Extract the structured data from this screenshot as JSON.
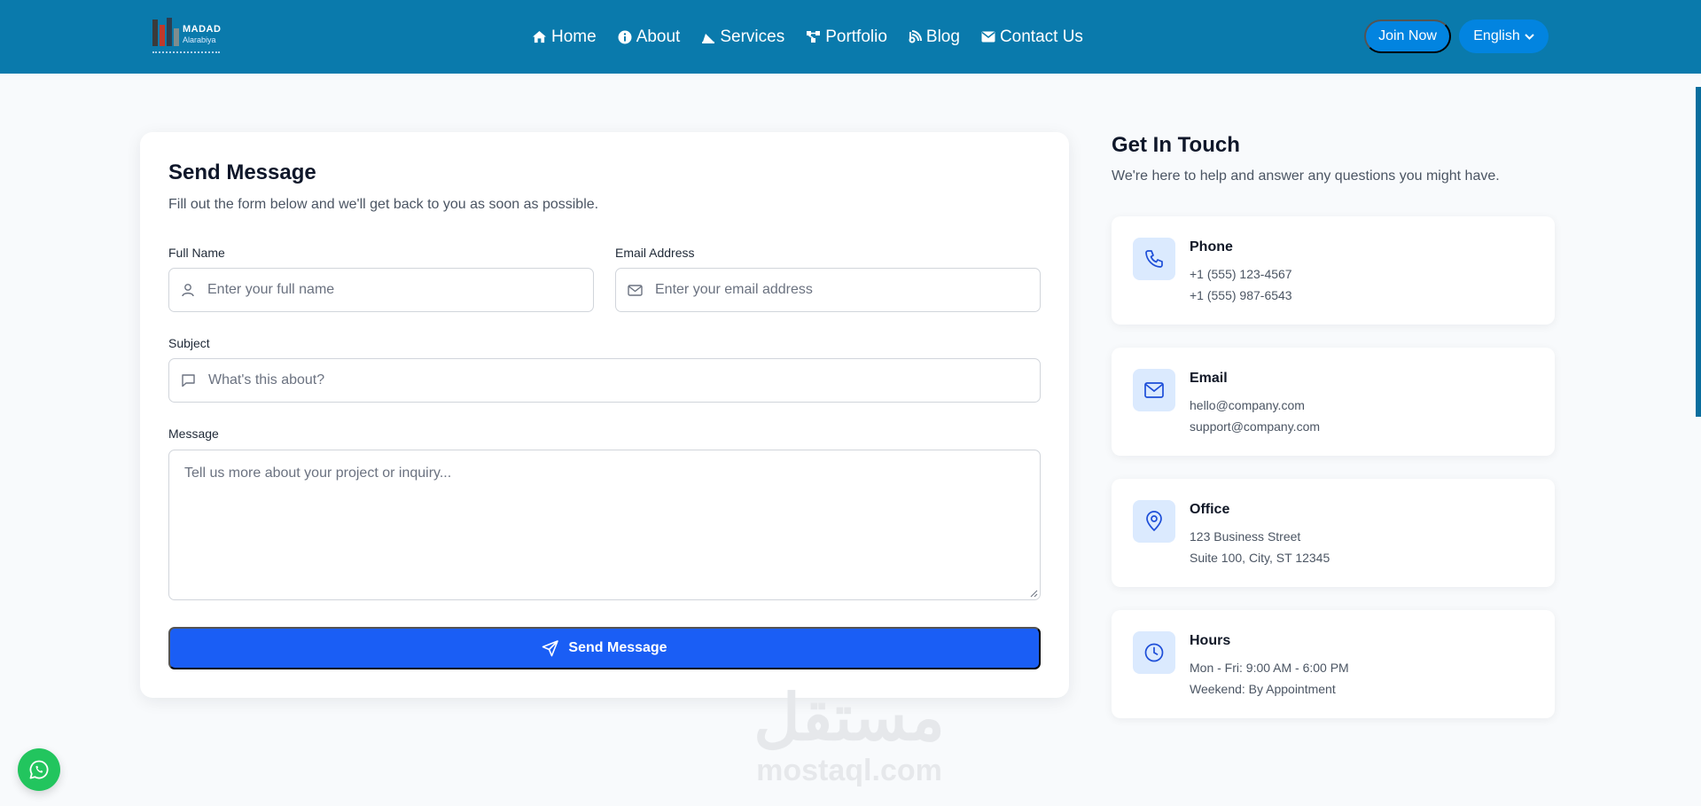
{
  "header": {
    "logo_title": "MADAD",
    "logo_subtitle": "Alarabiya",
    "nav": [
      {
        "label": "Home",
        "icon": "home-icon"
      },
      {
        "label": "About",
        "icon": "info-icon"
      },
      {
        "label": "Services",
        "icon": "services-icon"
      },
      {
        "label": "Portfolio",
        "icon": "portfolio-icon"
      },
      {
        "label": "Blog",
        "icon": "blog-icon"
      },
      {
        "label": "Contact Us",
        "icon": "envelope-icon"
      }
    ],
    "join_label": "Join Now",
    "language": "English"
  },
  "form": {
    "title": "Send Message",
    "subtitle": "Fill out the form below and we'll get back to you as soon as possible.",
    "full_name": {
      "label": "Full Name",
      "placeholder": "Enter your full name",
      "value": ""
    },
    "email": {
      "label": "Email Address",
      "placeholder": "Enter your email address",
      "value": ""
    },
    "subject": {
      "label": "Subject",
      "placeholder": "What's this about?",
      "value": ""
    },
    "message": {
      "label": "Message",
      "placeholder": "Tell us more about your project or inquiry...",
      "value": ""
    },
    "submit_label": "Send Message"
  },
  "contact": {
    "title": "Get In Touch",
    "subtitle": "We're here to help and answer any questions you might have.",
    "cards": [
      {
        "title": "Phone",
        "icon": "phone-icon",
        "lines": [
          "+1 (555) 123-4567",
          "+1 (555) 987-6543"
        ]
      },
      {
        "title": "Email",
        "icon": "mail-icon",
        "lines": [
          "hello@company.com",
          "support@company.com"
        ]
      },
      {
        "title": "Office",
        "icon": "map-pin-icon",
        "lines": [
          "123 Business Street",
          "Suite 100, City, ST 12345"
        ]
      },
      {
        "title": "Hours",
        "icon": "clock-icon",
        "lines": [
          "Mon - Fri: 9:00 AM - 6:00 PM",
          "Weekend: By Appointment"
        ]
      }
    ]
  },
  "watermark": {
    "arabic": "مستقل",
    "latin": "mostaql.com"
  },
  "colors": {
    "navbar": "#0a7aac",
    "primary": "#1a5ef5",
    "whatsapp": "#22c55e",
    "icon_bg": "#dbeafe",
    "icon": "#1d4ed8"
  }
}
